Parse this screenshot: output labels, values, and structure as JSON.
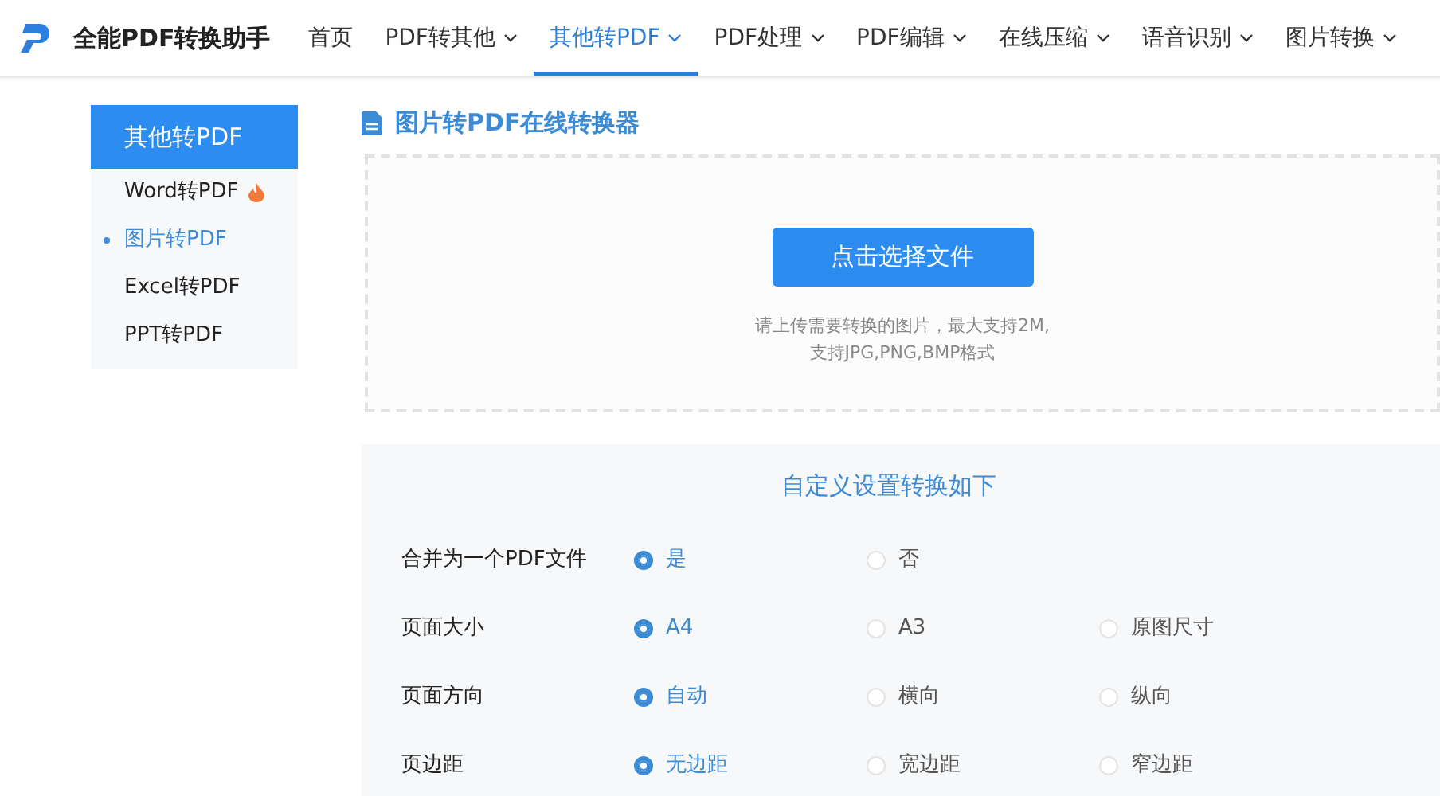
{
  "brand": "全能PDF转换助手",
  "nav": [
    {
      "label": "首页",
      "selected": false,
      "dropdown": false
    },
    {
      "label": "PDF转其他",
      "selected": false,
      "dropdown": true
    },
    {
      "label": "其他转PDF",
      "selected": true,
      "dropdown": true
    },
    {
      "label": "PDF处理",
      "selected": false,
      "dropdown": true
    },
    {
      "label": "PDF编辑",
      "selected": false,
      "dropdown": true
    },
    {
      "label": "在线压缩",
      "selected": false,
      "dropdown": true
    },
    {
      "label": "语音识别",
      "selected": false,
      "dropdown": true
    },
    {
      "label": "图片转换",
      "selected": false,
      "dropdown": true
    }
  ],
  "sidebar": {
    "title": "其他转PDF",
    "items": [
      {
        "label": "Word转PDF",
        "selected": false,
        "hot": true
      },
      {
        "label": "图片转PDF",
        "selected": true,
        "hot": false
      },
      {
        "label": "Excel转PDF",
        "selected": false,
        "hot": false
      },
      {
        "label": "PPT转PDF",
        "selected": false,
        "hot": false
      }
    ]
  },
  "page_title": "图片转PDF在线转换器",
  "upload": {
    "button": "点击选择文件",
    "hints": [
      "请上传需要转换的图片，最大支持2M,",
      "支持JPG,PNG,BMP格式"
    ]
  },
  "settings": {
    "title": "自定义设置转换如下",
    "rows": [
      {
        "label": "合并为一个PDF文件",
        "options": [
          {
            "label": "是",
            "selected": true
          },
          {
            "label": "否",
            "selected": false
          }
        ]
      },
      {
        "label": "页面大小",
        "options": [
          {
            "label": "A4",
            "selected": true
          },
          {
            "label": "A3",
            "selected": false
          },
          {
            "label": "原图尺寸",
            "selected": false
          }
        ]
      },
      {
        "label": "页面方向",
        "options": [
          {
            "label": "自动",
            "selected": true
          },
          {
            "label": "横向",
            "selected": false
          },
          {
            "label": "纵向",
            "selected": false
          }
        ]
      },
      {
        "label": "页边距",
        "options": [
          {
            "label": "无边距",
            "selected": true
          },
          {
            "label": "宽边距",
            "selected": false
          },
          {
            "label": "窄边距",
            "selected": false
          }
        ]
      }
    ]
  }
}
